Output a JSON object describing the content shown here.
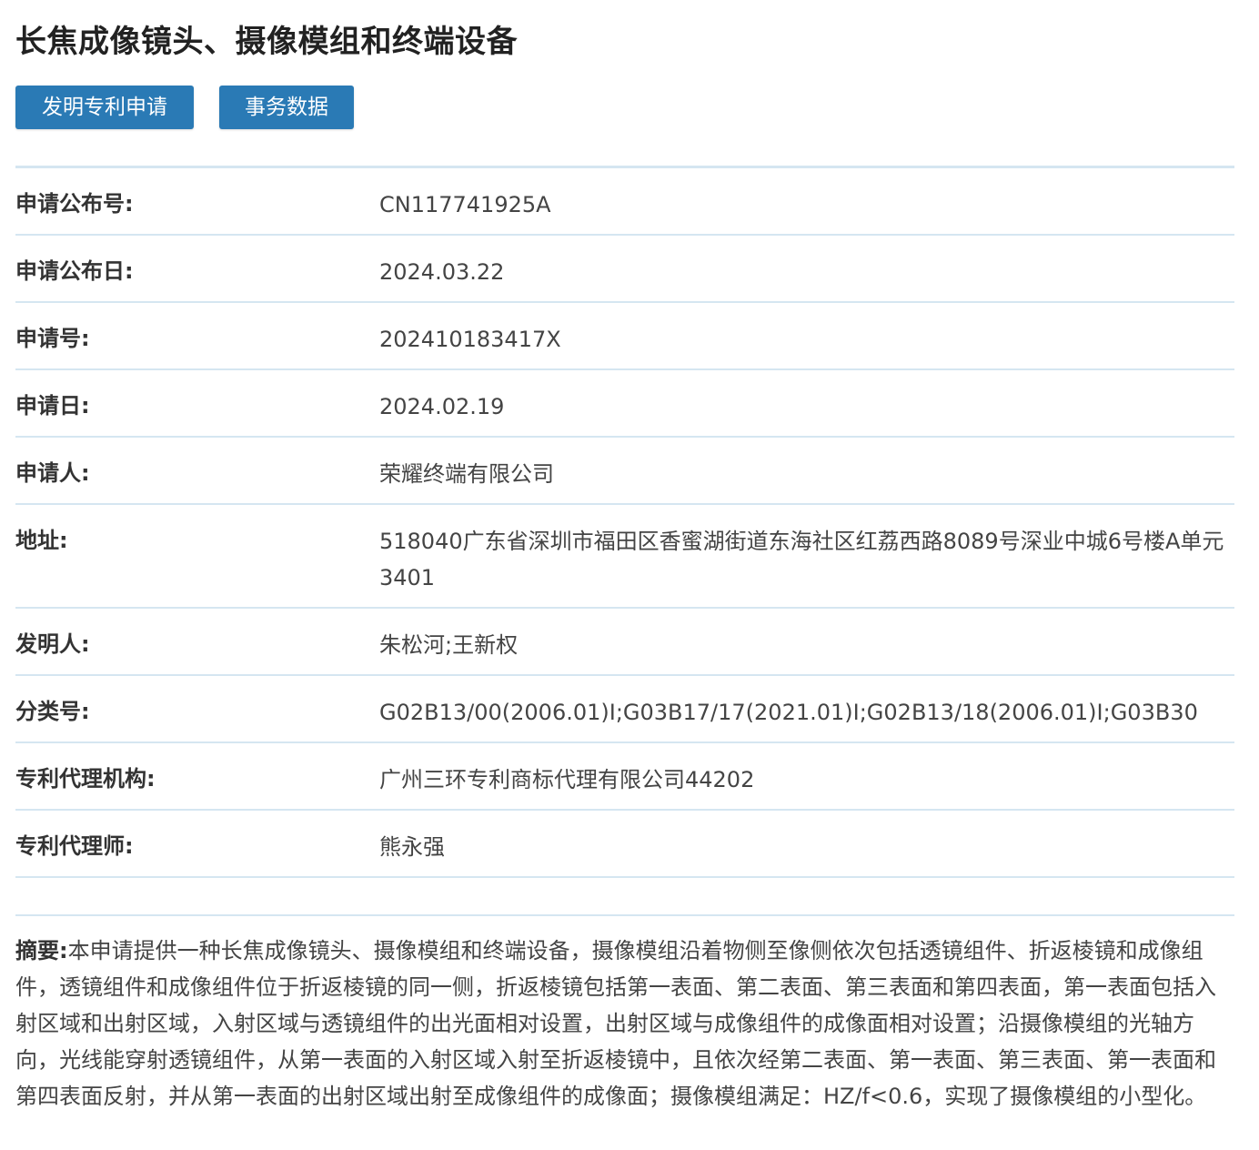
{
  "title": "长焦成像镜头、摄像模组和终端设备",
  "buttons": {
    "apply": "发明专利申请",
    "affairs": "事务数据"
  },
  "fields": [
    {
      "label": "申请公布号:",
      "value": "CN117741925A"
    },
    {
      "label": "申请公布日:",
      "value": "2024.03.22"
    },
    {
      "label": "申请号:",
      "value": "202410183417X"
    },
    {
      "label": "申请日:",
      "value": "2024.02.19"
    },
    {
      "label": "申请人:",
      "value": "荣耀终端有限公司"
    },
    {
      "label": "地址:",
      "value": "518040广东省深圳市福田区香蜜湖街道东海社区红荔西路8089号深业中城6号楼A单元3401"
    },
    {
      "label": "发明人:",
      "value": "朱松河;王新权"
    },
    {
      "label": "分类号:",
      "value": "G02B13/00(2006.01)I;G03B17/17(2021.01)I;G02B13/18(2006.01)I;G03B30"
    },
    {
      "label": "专利代理机构:",
      "value": "广州三环专利商标代理有限公司44202"
    },
    {
      "label": "专利代理师:",
      "value": "熊永强"
    }
  ],
  "abstract": {
    "label": "摘要:",
    "text": "本申请提供一种长焦成像镜头、摄像模组和终端设备，摄像模组沿着物侧至像侧依次包括透镜组件、折返棱镜和成像组件，透镜组件和成像组件位于折返棱镜的同一侧，折返棱镜包括第一表面、第二表面、第三表面和第四表面，第一表面包括入射区域和出射区域，入射区域与透镜组件的出光面相对设置，出射区域与成像组件的成像面相对设置；沿摄像模组的光轴方向，光线能穿射透镜组件，从第一表面的入射区域入射至折返棱镜中，且依次经第二表面、第一表面、第三表面、第一表面和第四表面反射，并从第一表面的出射区域出射至成像组件的成像面；摄像模组满足：HZ/f<0.6，实现了摄像模组的小型化。"
  }
}
